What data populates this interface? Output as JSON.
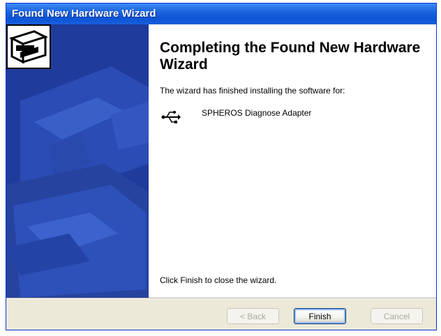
{
  "window": {
    "title": "Found New Hardware Wizard"
  },
  "main": {
    "heading": "Completing the Found New Hardware Wizard",
    "intro": "The wizard has finished installing the software for:",
    "device_name": "SPHEROS Diagnose Adapter",
    "footer": "Click Finish to close the wizard."
  },
  "buttons": {
    "back_label": "< Back",
    "finish_label": "Finish",
    "cancel_label": "Cancel"
  },
  "icons": {
    "hardware": "hardware-wizard-icon",
    "device": "usb-icon"
  },
  "colors": {
    "titlebar": "#0b54d6",
    "side_panel": "#1f3b9c",
    "window_bg": "#ece9d8"
  }
}
